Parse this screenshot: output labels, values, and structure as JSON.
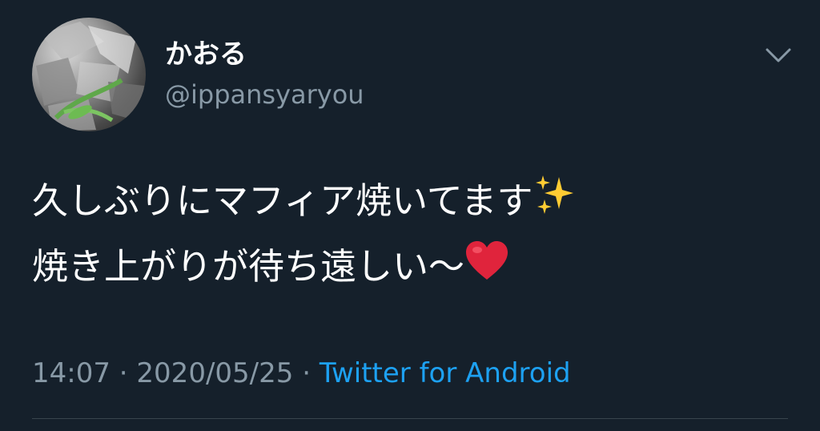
{
  "tweet": {
    "display_name": "かおる",
    "handle": "@ippansyaryou",
    "text_line1": "久しぶりにマフィア焼いてます",
    "text_line2": "焼き上がりが待ち遠しい〜",
    "emoji_line1": "sparkles-icon",
    "emoji_line2": "red-heart-icon",
    "time": "14:07",
    "separator": " · ",
    "date": "2020/05/25",
    "source": "Twitter for Android"
  },
  "colors": {
    "background": "#15202b",
    "text_primary": "#ffffff",
    "text_secondary": "#8899a6",
    "link": "#1da1f2",
    "divider": "#38444d",
    "heart": "#e0243c",
    "sparkle": "#ffcc33"
  }
}
